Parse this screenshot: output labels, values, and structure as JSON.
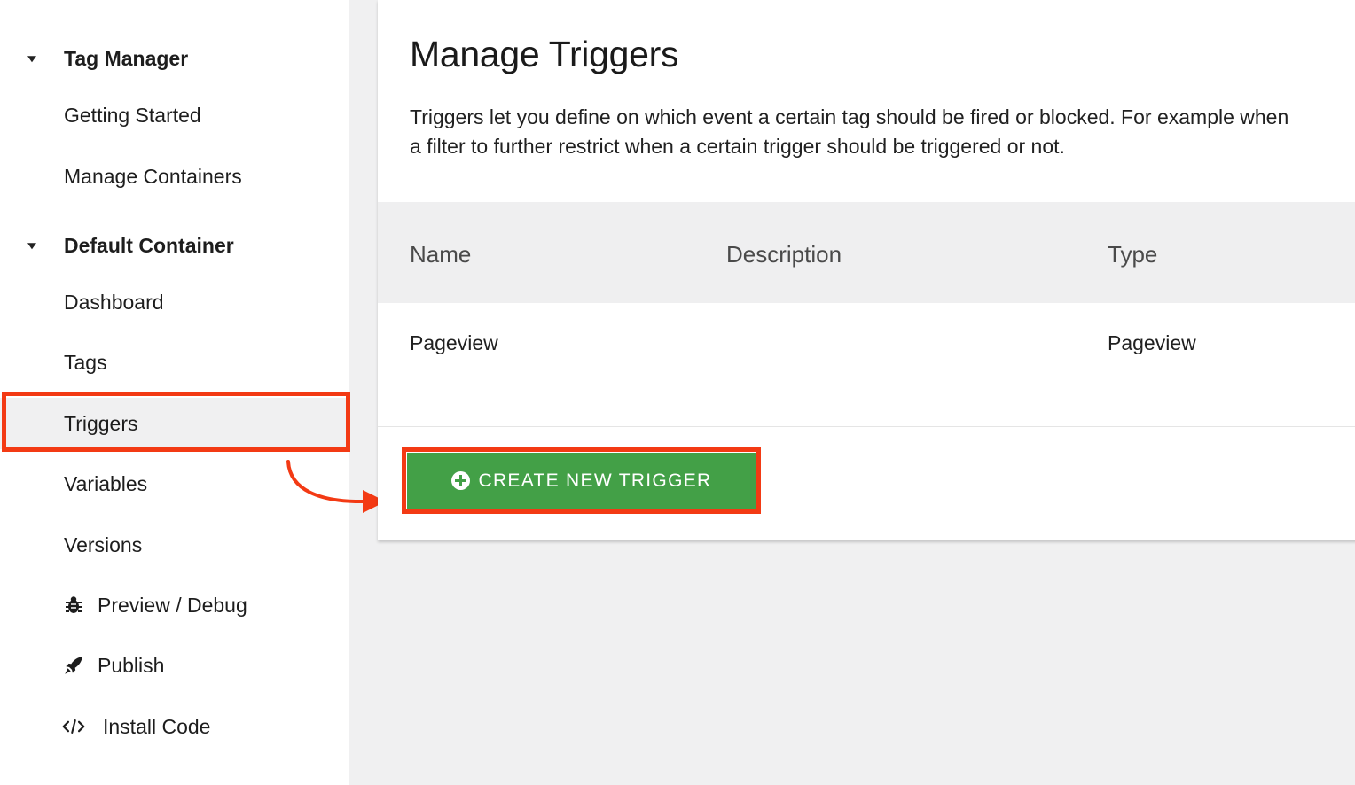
{
  "sidebar": {
    "groups": [
      {
        "title": "Tag Manager"
      },
      {
        "title": "Default Container"
      }
    ],
    "tag_manager_items": [
      {
        "label": "Getting Started"
      },
      {
        "label": "Manage Containers"
      }
    ],
    "container_items": [
      {
        "label": "Dashboard"
      },
      {
        "label": "Tags"
      },
      {
        "label": "Triggers",
        "active": true
      },
      {
        "label": "Variables"
      },
      {
        "label": "Versions"
      },
      {
        "label": "Preview / Debug",
        "icon": "bug-icon"
      },
      {
        "label": "Publish",
        "icon": "rocket-icon"
      },
      {
        "label": "Install Code",
        "icon": "code-icon"
      }
    ]
  },
  "main": {
    "title": "Manage Triggers",
    "intro_line1": "Triggers let you define on which event a certain tag should be fired or blocked. For example when",
    "intro_line2": "a filter to further restrict when a certain trigger should be triggered or not.",
    "table": {
      "columns": [
        "Name",
        "Description",
        "Type"
      ],
      "rows": [
        {
          "name": "Pageview",
          "description": "",
          "type": "Pageview"
        }
      ]
    },
    "create_button": {
      "label": "CREATE NEW TRIGGER",
      "icon": "plus-circle-icon"
    }
  },
  "colors": {
    "accent_green": "#43a047",
    "annotation_red": "#f33a14",
    "sidebar_bg": "#ffffff",
    "page_bg": "#f0f0f1"
  }
}
